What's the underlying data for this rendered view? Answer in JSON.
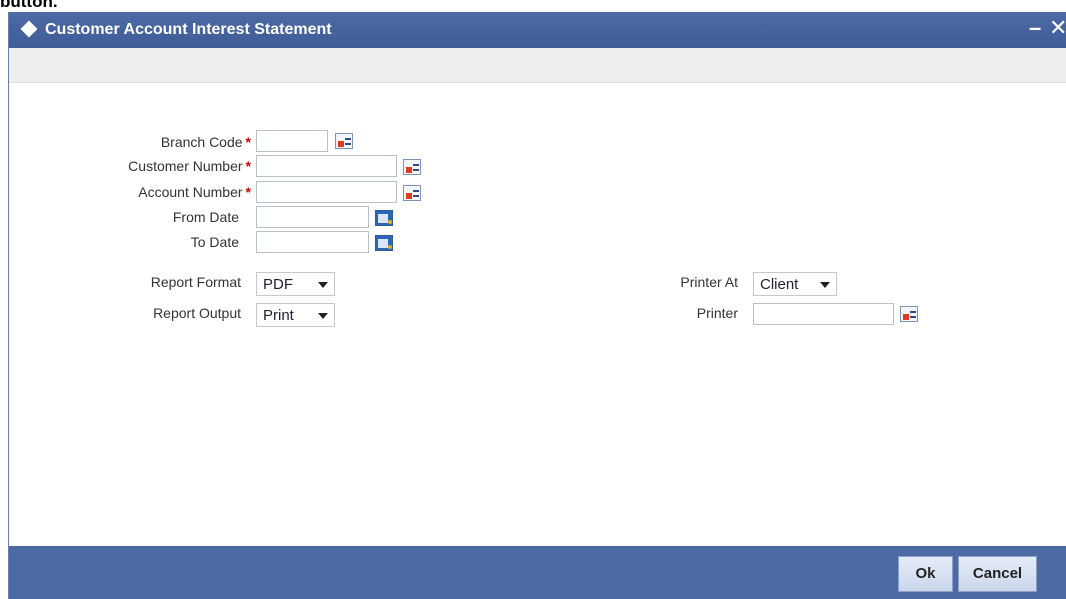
{
  "cut_text": "button.",
  "window": {
    "title": "Customer Account Interest Statement",
    "minimize_glyph": "–",
    "close_glyph": "✕"
  },
  "form": {
    "branch_code_label": "Branch Code",
    "customer_number_label": "Customer Number",
    "account_number_label": "Account Number",
    "from_date_label": "From Date",
    "to_date_label": "To Date",
    "required_marker": "*",
    "report_format_label": "Report Format",
    "report_format_value": "PDF",
    "report_output_label": "Report Output",
    "report_output_value": "Print",
    "printer_at_label": "Printer At",
    "printer_at_value": "Client",
    "printer_label": "Printer"
  },
  "footer": {
    "ok_label": "Ok",
    "cancel_label": "Cancel"
  },
  "icons": {
    "lov": "list-of-values-icon",
    "calendar": "calendar-icon"
  },
  "colors": {
    "titlebar": "#4d6aa5",
    "required": "#d40000"
  }
}
